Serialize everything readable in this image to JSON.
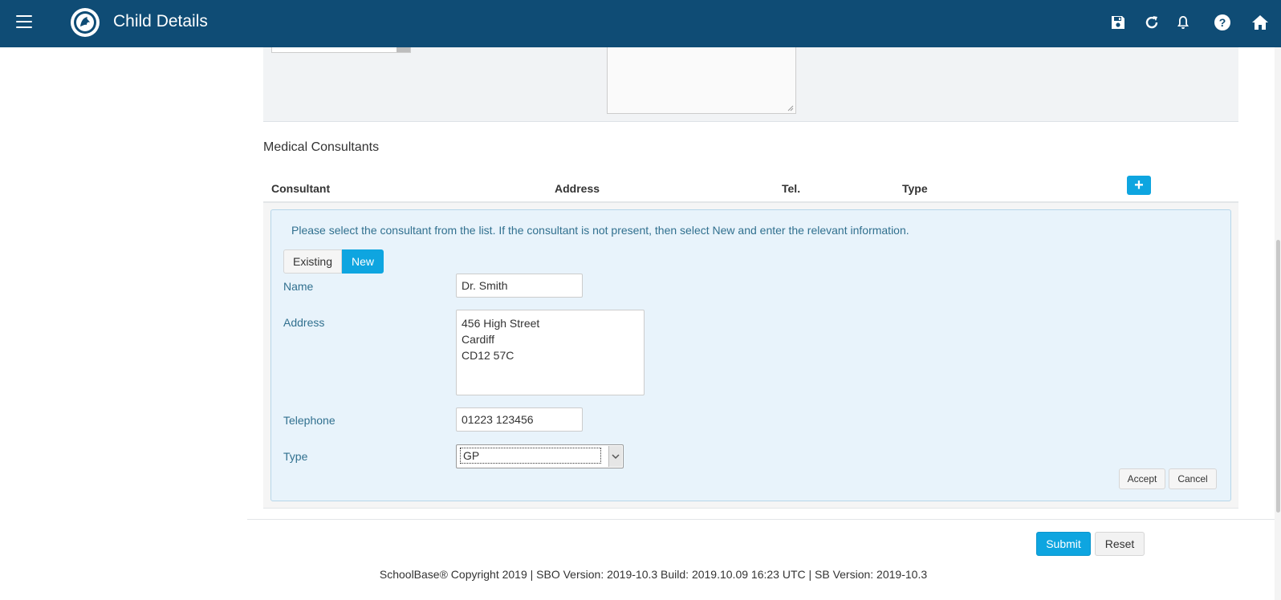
{
  "header": {
    "title": "Child Details",
    "icons": [
      "menu-icon",
      "logo",
      "save-icon",
      "refresh-icon",
      "bell-icon",
      "help-icon",
      "home-icon"
    ]
  },
  "section": {
    "title": "Medical Consultants"
  },
  "table": {
    "columns": [
      "Consultant",
      "Address",
      "Tel.",
      "Type"
    ],
    "add_label": "+"
  },
  "form": {
    "info": "Please select the consultant from the list. If the consultant is not present, then select New and enter the relevant information.",
    "toggle": {
      "existing": "Existing",
      "new": "New",
      "selected": "New"
    },
    "name_label": "Name",
    "name_value": "Dr. Smith",
    "address_label": "Address",
    "address_value": "456 High Street\nCardiff\nCD12 57C",
    "telephone_label": "Telephone",
    "telephone_value": "01223 123456",
    "type_label": "Type",
    "type_value": "GP",
    "accept": "Accept",
    "cancel": "Cancel"
  },
  "actions": {
    "submit": "Submit",
    "reset": "Reset"
  },
  "footer": "SchoolBase® Copyright 2019 | SBO Version: 2019-10.3 Build: 2019.10.09 16:23 UTC | SB Version: 2019-10.3",
  "colors": {
    "header": "#0f4c75",
    "accent": "#0ea5e0",
    "info_bg": "#e8f3fb",
    "info_text": "#31708f"
  }
}
